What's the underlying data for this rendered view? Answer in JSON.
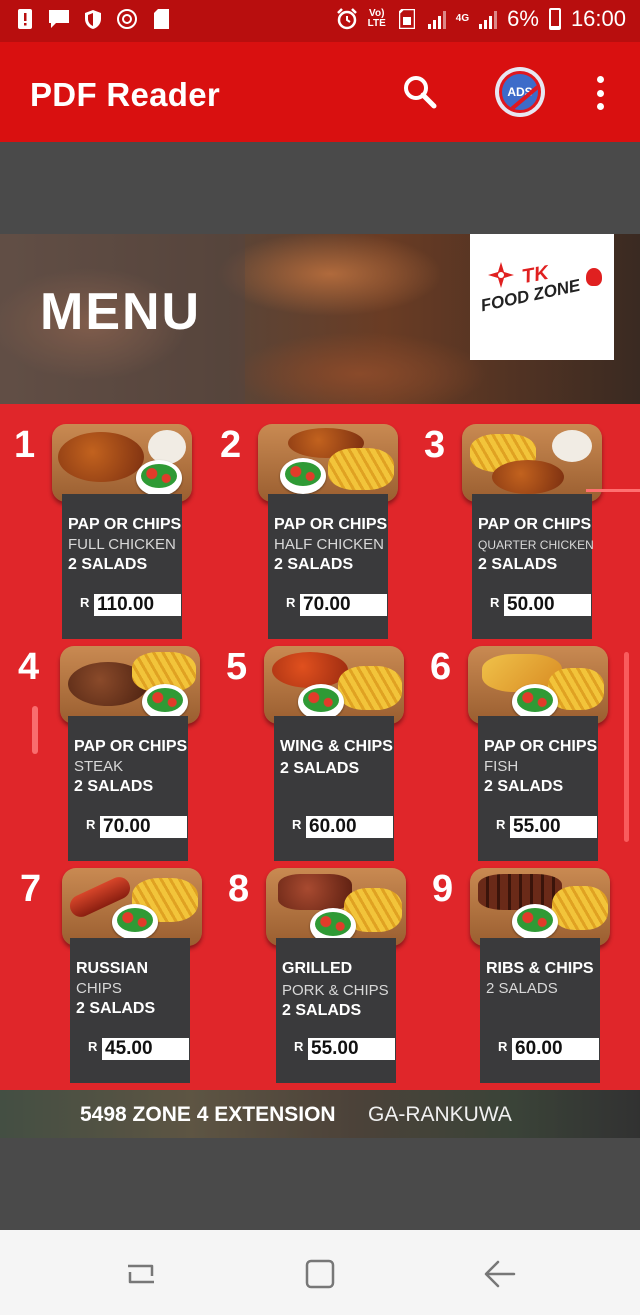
{
  "status_bar": {
    "battery_percent": "6%",
    "time": "16:00",
    "network_type": "4G",
    "volte_label_top": "Vo)",
    "volte_label_bottom": "LTE"
  },
  "app_bar": {
    "title": "PDF Reader",
    "ads_label": "ADS"
  },
  "menu": {
    "heading": "MENU",
    "logo_line1": "TK",
    "logo_line2": "FOOD ZONE",
    "currency": "R",
    "items": [
      {
        "number": "1",
        "line1": "PAP OR CHIPS",
        "line2": "FULL CHICKEN",
        "line3": "2 SALADS",
        "price": "110.00"
      },
      {
        "number": "2",
        "line1": "PAP OR CHIPS",
        "line2": "HALF CHICKEN",
        "line3": "2 SALADS",
        "price": "70.00"
      },
      {
        "number": "3",
        "line1": "PAP OR CHIPS",
        "line2": "QUARTER CHICKEN",
        "line3": "2 SALADS",
        "price": "50.00"
      },
      {
        "number": "4",
        "line1": "PAP OR CHIPS",
        "line2": "STEAK",
        "line3": "2 SALADS",
        "price": "70.00"
      },
      {
        "number": "5",
        "line1": "WING & CHIPS",
        "line2": "",
        "line3": "2 SALADS",
        "price": "60.00"
      },
      {
        "number": "6",
        "line1": "PAP OR CHIPS",
        "line2": "FISH",
        "line3": "2 SALADS",
        "price": "55.00"
      },
      {
        "number": "7",
        "line1": "RUSSIAN",
        "line2": "CHIPS",
        "line3": "2 SALADS",
        "price": "45.00"
      },
      {
        "number": "8",
        "line1": "GRILLED",
        "line2": "PORK & CHIPS",
        "line3": "2 SALADS",
        "price": "55.00"
      },
      {
        "number": "9",
        "line1": "RIBS & CHIPS",
        "line2": "2 SALADS",
        "line3": "",
        "price": "60.00"
      }
    ],
    "address_bold": "5498 ZONE 4 EXTENSION",
    "address_light": "GA-RANKUWA"
  },
  "colors": {
    "app_bar": "#d91010",
    "status_bar": "#b80e0e",
    "menu_red": "#e0262a",
    "card_dark": "#3a3a3c"
  }
}
